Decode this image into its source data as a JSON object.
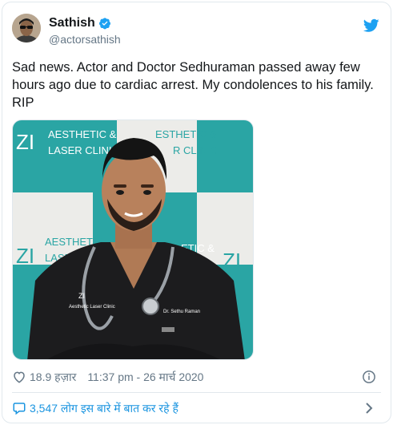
{
  "author": {
    "display_name": "Sathish",
    "handle": "@actorsathish"
  },
  "tweet": {
    "text": "Sad news. Actor and Doctor Sedhuraman passed away few hours ago due to cardiac arrest. My condolences to his family. RIP"
  },
  "media": {
    "backdrop_logo": "ZI",
    "backdrop_text_line1": "AESTHETIC &",
    "backdrop_text_line2": "LASER CLINIC",
    "backdrop_text_right_line1": "ESTHETIC &",
    "backdrop_text_right_line2": "R CLINIC",
    "backdrop_text_lower_line1": "AESTHETIC",
    "backdrop_text_lower_line2": "LASE",
    "backdrop_text_lower_right": "ETIC &",
    "coat_logo": "ZI",
    "coat_logo_text": "Aesthetic Laser Clinic",
    "coat_name": "Dr. Sethu Raman"
  },
  "meta": {
    "likes": "18.9 हज़ार",
    "timestamp": "11:37 pm - 26 मार्च 2020"
  },
  "conversation": {
    "label": "3,547 लोग इस बारे में बात कर रहे हैं"
  },
  "colors": {
    "accent": "#1b95e0",
    "secondary_text": "#657786",
    "primary_text": "#14171a",
    "verified_blue": "#1da1f2",
    "backdrop_teal": "#2aa5a4"
  },
  "icons": {
    "verified": "verified-badge-icon",
    "twitter": "twitter-bird-icon",
    "like": "heart-icon",
    "info": "info-icon",
    "reply": "comment-icon",
    "more": "chevron-right-icon"
  }
}
